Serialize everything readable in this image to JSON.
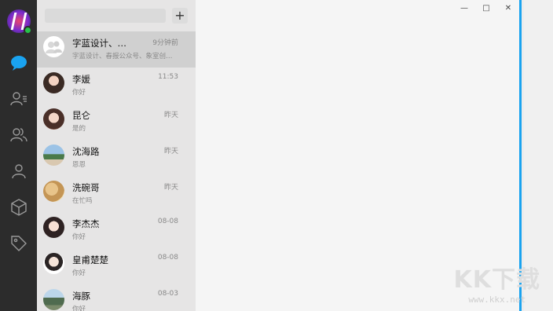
{
  "window_controls": {
    "minimize": "—",
    "maximize": "□",
    "close": "✕"
  },
  "search": {
    "add_label": "+"
  },
  "conversations": [
    {
      "name": "字蓝设计、…",
      "time": "9分钟前",
      "preview": "字蓝设计、春报公众号、象室创…",
      "avatar": "group-avatar",
      "active": true
    },
    {
      "name": "李媛",
      "time": "11:53",
      "preview": "你好",
      "avatar": "user-avatar"
    },
    {
      "name": "昆仑",
      "time": "昨天",
      "preview": "是的",
      "avatar": "user-avatar"
    },
    {
      "name": "沈海路",
      "time": "昨天",
      "preview": "恩恩",
      "avatar": "user-avatar"
    },
    {
      "name": "洗碗哥",
      "time": "昨天",
      "preview": "在忙吗",
      "avatar": "user-avatar"
    },
    {
      "name": "李杰杰",
      "time": "08-08",
      "preview": "你好",
      "avatar": "user-avatar"
    },
    {
      "name": "皇甫楚楚",
      "time": "08-08",
      "preview": "你好",
      "avatar": "user-avatar"
    },
    {
      "name": "海豚",
      "time": "08-03",
      "preview": "你好",
      "avatar": "user-avatar"
    }
  ],
  "watermark": {
    "logo": "KK下载",
    "url": "www.kkx.net"
  },
  "colors": {
    "rail": "#2c2c2c",
    "accent": "#1aa3f0",
    "list_bg": "#e6e5e5",
    "online": "#27c24a"
  }
}
